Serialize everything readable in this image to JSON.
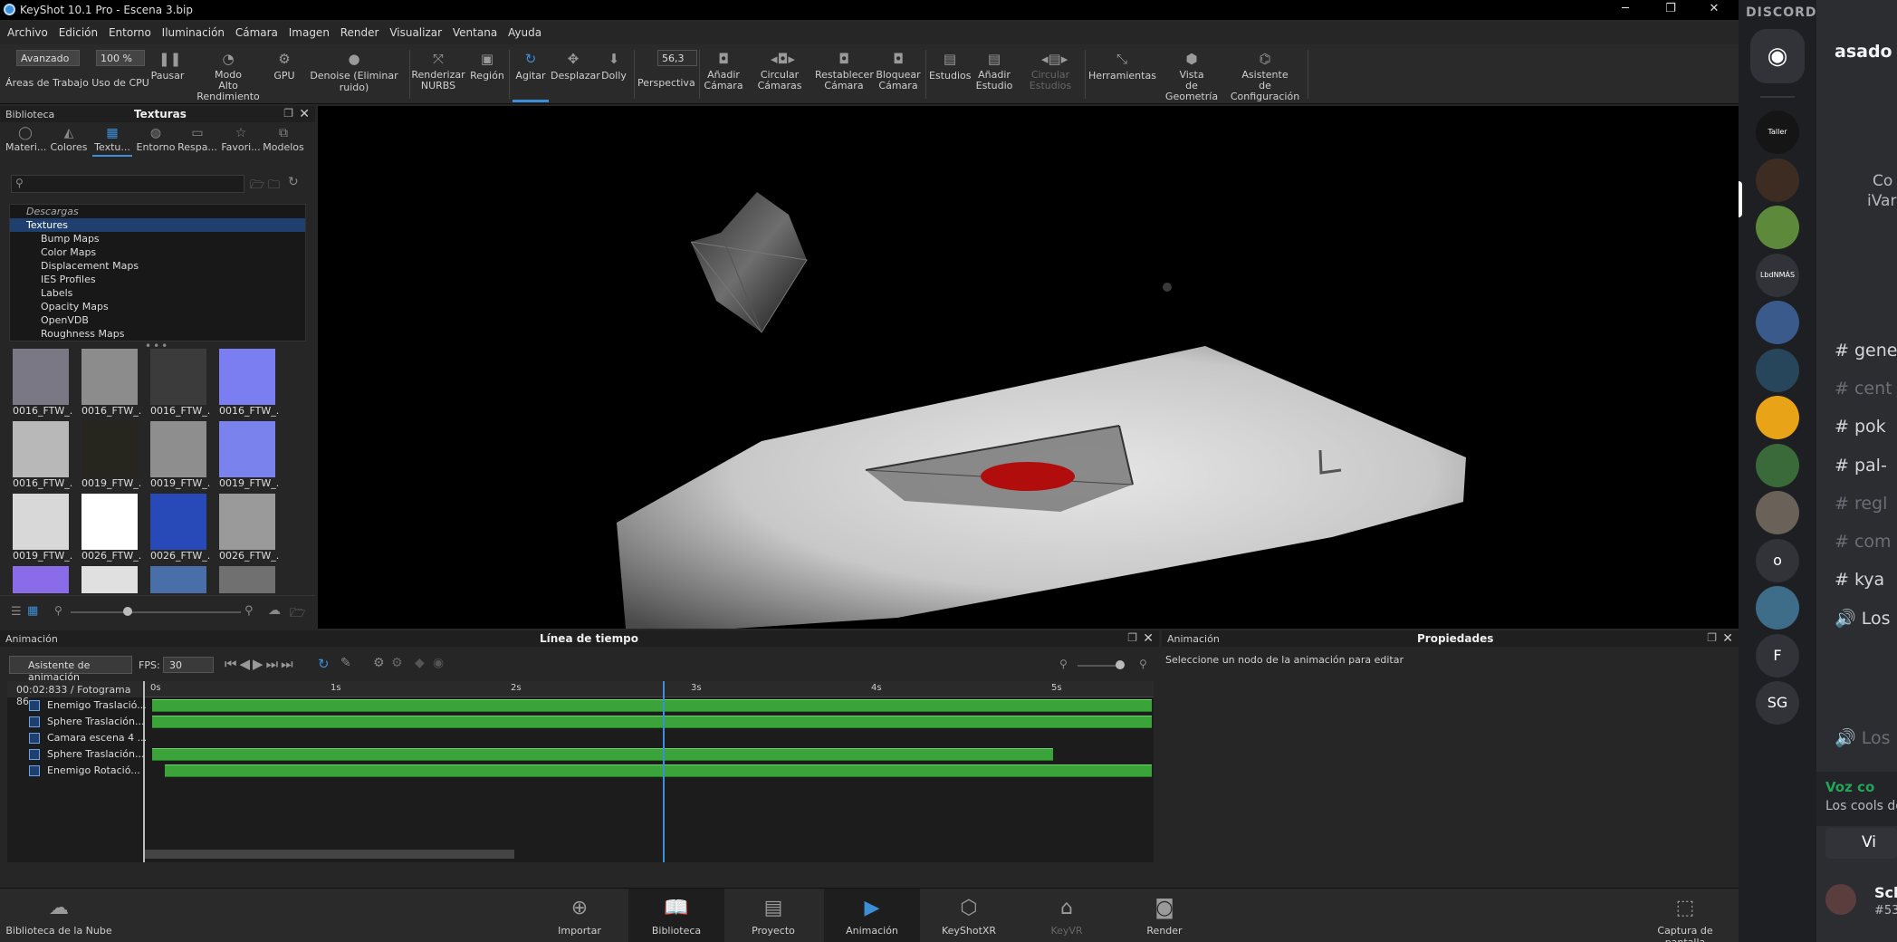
{
  "window": {
    "title": "KeyShot 10.1 Pro  - Escena 3.bip",
    "min": "─",
    "max": "❐",
    "close": "✕"
  },
  "menu": [
    "Archivo",
    "Edición",
    "Entorno",
    "Iluminación",
    "Cámara",
    "Imagen",
    "Render",
    "Visualizar",
    "Ventana",
    "Ayuda"
  ],
  "toolbar": {
    "workspace_dropdown": "Avanzado",
    "workspace_label": "Áreas de Trabajo",
    "cpu_dropdown": "100 %",
    "cpu_label": "Uso de CPU",
    "pause": "Pausar",
    "perf_mode": "Modo\nAlto Rendimiento",
    "gpu": "GPU",
    "denoise": "Denoise (Eliminar ruido)",
    "nurbs": "Renderizar\nNURBS",
    "region": "Región",
    "tumble": "Agitar",
    "pan": "Desplazar",
    "dolly": "Dolly",
    "fov_value": "56,3",
    "perspective": "Perspectiva",
    "add_camera": "Añadir\nCámara",
    "cycle_cameras": "Circular\nCámaras",
    "reset_camera": "Restablecer\nCámara",
    "lock_camera": "Bloquear\nCámara",
    "studios": "Estudios",
    "add_studio": "Añadir\nEstudio",
    "cycle_studios": "Circular\nEstudios",
    "tools": "Herramientas",
    "geometry_view": "Vista\nde Geometría",
    "config_wizard": "Asistente\nde Configuración"
  },
  "library": {
    "header_left": "Biblioteca",
    "header_title": "Texturas",
    "tabs": [
      "Materi...",
      "Colores",
      "Textu...",
      "Entorno",
      "Respa...",
      "Favori...",
      "Modelos"
    ],
    "tree": [
      {
        "label": "Descargas",
        "style": "it"
      },
      {
        "label": "Textures",
        "style": "sel"
      },
      {
        "label": "Bump Maps",
        "style": "c1"
      },
      {
        "label": "Color Maps",
        "style": "c1"
      },
      {
        "label": "Displacement Maps",
        "style": "c1"
      },
      {
        "label": "IES Profiles",
        "style": "c1"
      },
      {
        "label": "Labels",
        "style": "c1"
      },
      {
        "label": "Opacity Maps",
        "style": "c1"
      },
      {
        "label": "OpenVDB",
        "style": "c1"
      },
      {
        "label": "Roughness Maps",
        "style": "c1"
      }
    ],
    "thumbs": [
      {
        "label": "0016_FTW_...",
        "color": "#7b7886"
      },
      {
        "label": "0016_FTW_...",
        "color": "#8c8c8c"
      },
      {
        "label": "0016_FTW_...",
        "color": "#3b3b3b"
      },
      {
        "label": "0016_FTW_...",
        "color": "#7a7ef0"
      },
      {
        "label": "0016_FTW_...",
        "color": "#b8b8b8"
      },
      {
        "label": "0019_FTW_...",
        "color": "#26261f"
      },
      {
        "label": "0019_FTW_...",
        "color": "#8e8e8e"
      },
      {
        "label": "0019_FTW_...",
        "color": "#7a82ee"
      },
      {
        "label": "0019_FTW_...",
        "color": "#d8d8d8"
      },
      {
        "label": "0026_FTW_...",
        "color": "#ffffff"
      },
      {
        "label": "0026_FTW_...",
        "color": "#2849b8"
      },
      {
        "label": "0026_FTW_...",
        "color": "#9a9a9a"
      },
      {
        "label": "",
        "color": "#8a6be8"
      },
      {
        "label": "",
        "color": "#e0e0e0"
      },
      {
        "label": "",
        "color": "#4a6ea8"
      },
      {
        "label": "",
        "color": "#707070"
      }
    ]
  },
  "animation": {
    "header_left": "Animación",
    "header_title": "Línea de tiempo",
    "wizard": "Asistente de animación",
    "fps_label": "FPS:",
    "fps": "30",
    "time_readout": "00:02:833 / Fotograma 86",
    "ruler": [
      "0s",
      "1s",
      "2s",
      "3s",
      "4s",
      "5s"
    ],
    "playhead_seconds": 2.833,
    "tracks": [
      {
        "name": "Enemigo Traslació...",
        "start": 0.0,
        "end": 5.55
      },
      {
        "name": "Sphere Traslación...",
        "start": 0.0,
        "end": 5.55
      },
      {
        "name": "Camara escena 4 ...",
        "start": null,
        "end": null
      },
      {
        "name": "Sphere Traslación...",
        "start": 0.0,
        "end": 5.0
      },
      {
        "name": "Enemigo Rotació...",
        "start": 0.07,
        "end": 5.55
      }
    ]
  },
  "properties": {
    "header_left": "Animación",
    "header_title": "Propiedades",
    "hint": "Seleccione un nodo de la animación para editar"
  },
  "bottombar": {
    "cloud": "Biblioteca de la Nube",
    "import": "Importar",
    "library": "Biblioteca",
    "project": "Proyecto",
    "animation": "Animación",
    "keyshotxr": "KeyShotXR",
    "keyvr": "KeyVR",
    "render": "Render",
    "screenshot": "Captura de pantalla"
  },
  "discord": {
    "brand": "DISCORD",
    "server_title": "asado fa",
    "connect": "Co",
    "connect2": "iVar",
    "servers": [
      {
        "label": "Taller Integrado MID",
        "color": "#151515"
      },
      {
        "label": "",
        "color": "#3d2c22"
      },
      {
        "label": "",
        "color": "#5d8a3a"
      },
      {
        "label": "LbdNMÁS",
        "color": "#313338"
      },
      {
        "label": "",
        "color": "#3b5a8c"
      },
      {
        "label": "",
        "color": "#27465c"
      },
      {
        "label": "",
        "color": "#e8a317"
      },
      {
        "label": "",
        "color": "#3a6a3a"
      },
      {
        "label": "",
        "color": "#6a6258"
      },
      {
        "label": "o",
        "color": "#313338"
      },
      {
        "label": "",
        "color": "#3e6d8a"
      },
      {
        "label": "F",
        "color": "#313338"
      },
      {
        "label": "SG",
        "color": "#313338"
      }
    ],
    "channels": [
      {
        "label": "# gene",
        "muted": false
      },
      {
        "label": "# cent",
        "muted": true
      },
      {
        "label": "# pok",
        "muted": false
      },
      {
        "label": "# pal-",
        "muted": false
      },
      {
        "label": "# regl",
        "muted": true
      },
      {
        "label": "# com",
        "muted": true
      },
      {
        "label": "# kya",
        "muted": false
      },
      {
        "label": "🔊 Los",
        "muted": false
      },
      {
        "label": "🔊 Los",
        "muted": true
      }
    ],
    "voice_status": "Voz co",
    "voice_sub": "Los cools de",
    "video_btn": "Vi",
    "user_name": "Sch",
    "user_tag": "#53"
  }
}
